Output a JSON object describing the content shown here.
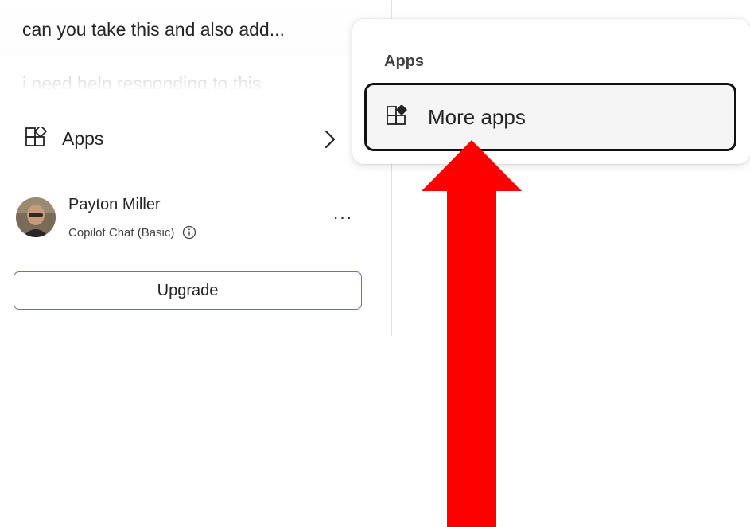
{
  "sidebar": {
    "recent_chats": [
      {
        "title": "can you take this and also add..."
      },
      {
        "title": "i need help responding to this"
      }
    ],
    "apps_entry": {
      "label": "Apps",
      "icon": "apps-icon",
      "chevron": "chevron-right-icon"
    },
    "user": {
      "name": "Payton Miller",
      "plan": "Copilot Chat (Basic)",
      "info_icon": "info-icon",
      "more_label": "···"
    },
    "upgrade_label": "Upgrade"
  },
  "apps_menu": {
    "heading": "Apps",
    "items": [
      {
        "label": "More apps",
        "icon": "more-apps-icon"
      }
    ]
  },
  "annotation": {
    "shape": "up-arrow",
    "color": "#ff0000"
  },
  "colors": {
    "upgrade_border": "#6a6ad0",
    "focus_ring": "#111111",
    "menu_item_bg": "#f5f5f5"
  }
}
